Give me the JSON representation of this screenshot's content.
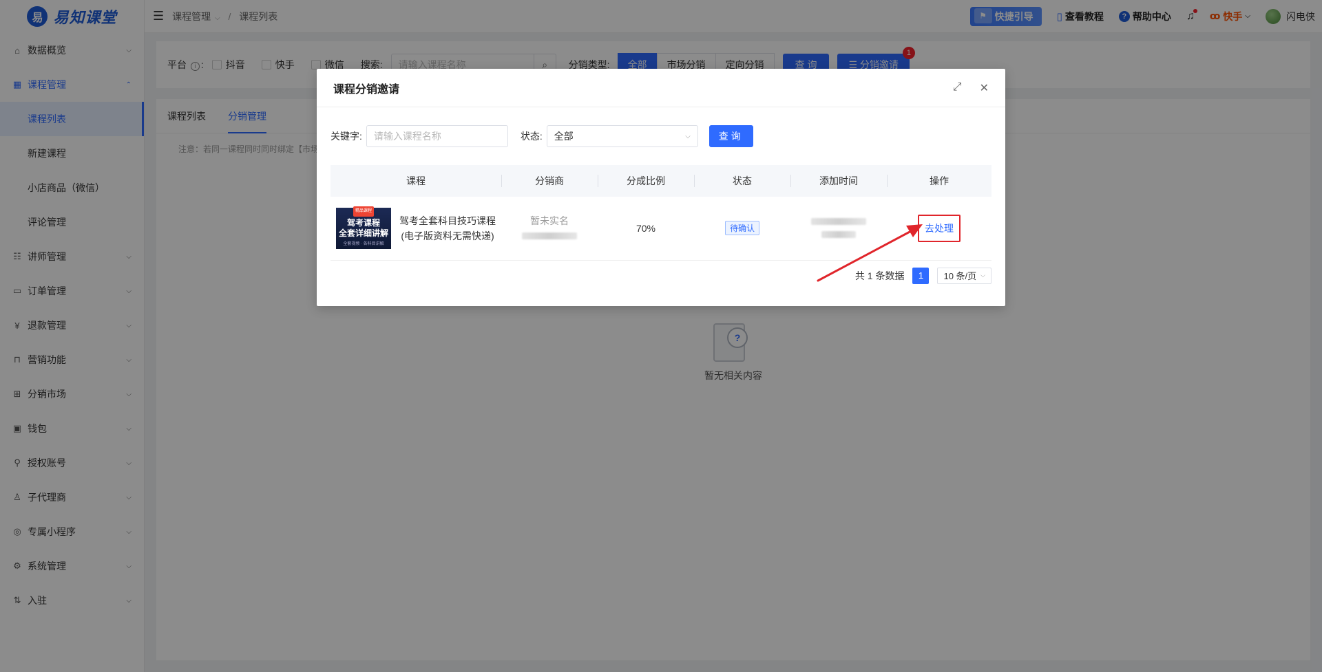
{
  "brand": {
    "logo_text": "易知课堂"
  },
  "sidebar": {
    "items": [
      {
        "label": "数据概览",
        "icon": "home-icon"
      },
      {
        "label": "课程管理",
        "icon": "grid-icon",
        "open": true,
        "children": [
          {
            "label": "课程列表",
            "active": true
          },
          {
            "label": "新建课程"
          },
          {
            "label": "小店商品（微信）"
          },
          {
            "label": "评论管理"
          }
        ]
      },
      {
        "label": "讲师管理",
        "icon": "teacher-icon"
      },
      {
        "label": "订单管理",
        "icon": "order-icon"
      },
      {
        "label": "退款管理",
        "icon": "refund-icon"
      },
      {
        "label": "营销功能",
        "icon": "marketing-icon"
      },
      {
        "label": "分销市场",
        "icon": "market-icon"
      },
      {
        "label": "钱包",
        "icon": "wallet-icon"
      },
      {
        "label": "授权账号",
        "icon": "auth-icon"
      },
      {
        "label": "子代理商",
        "icon": "agent-icon"
      },
      {
        "label": "专属小程序",
        "icon": "miniapp-icon"
      },
      {
        "label": "系统管理",
        "icon": "settings-icon"
      },
      {
        "label": "入驻",
        "icon": "settle-icon"
      }
    ]
  },
  "header": {
    "breadcrumb": [
      "课程管理",
      "课程列表"
    ],
    "quick_guide": "快捷引导",
    "tutorial": "查看教程",
    "help": "帮助中心",
    "platform": "快手",
    "username": "闪电侠"
  },
  "filter_bar": {
    "platform_label": "平台",
    "platforms": [
      "抖音",
      "快手",
      "微信"
    ],
    "search_label": "搜索:",
    "search_placeholder": "请输入课程名称",
    "type_label": "分销类型:",
    "types": [
      "全部",
      "市场分销",
      "定向分销"
    ],
    "query_btn": "查 询",
    "invite_btn": "分销邀请",
    "invite_badge": "1"
  },
  "content": {
    "tabs": [
      "课程列表",
      "分销管理"
    ],
    "active_tab": 1,
    "notice": "注意：若同一课程同时同时绑定【市场分销】",
    "empty_text": "暂无相关内容"
  },
  "modal": {
    "title": "课程分销邀请",
    "keyword_label": "关键字:",
    "keyword_placeholder": "请输入课程名称",
    "status_label": "状态:",
    "status_value": "全部",
    "query_btn": "查询",
    "columns": [
      "课程",
      "分销商",
      "分成比例",
      "状态",
      "添加时间",
      "操作"
    ],
    "rows": [
      {
        "thumb_tag": "精品课程",
        "thumb_line1": "驾考课程",
        "thumb_line2": "全套详细讲解",
        "thumb_sub": "全套视频 · 各科目讲解",
        "course": "驾考全套科目技巧课程(电子版资料无需快递)",
        "distributor": "暂未实名",
        "ratio": "70%",
        "status": "待确认",
        "action": "去处理"
      }
    ],
    "total_text": "共 1 条数据",
    "page": "1",
    "page_size": "10 条/页"
  },
  "colors": {
    "primary": "#2f6bff",
    "highlight_box": "#e0252b",
    "badge": "#f5222d"
  }
}
